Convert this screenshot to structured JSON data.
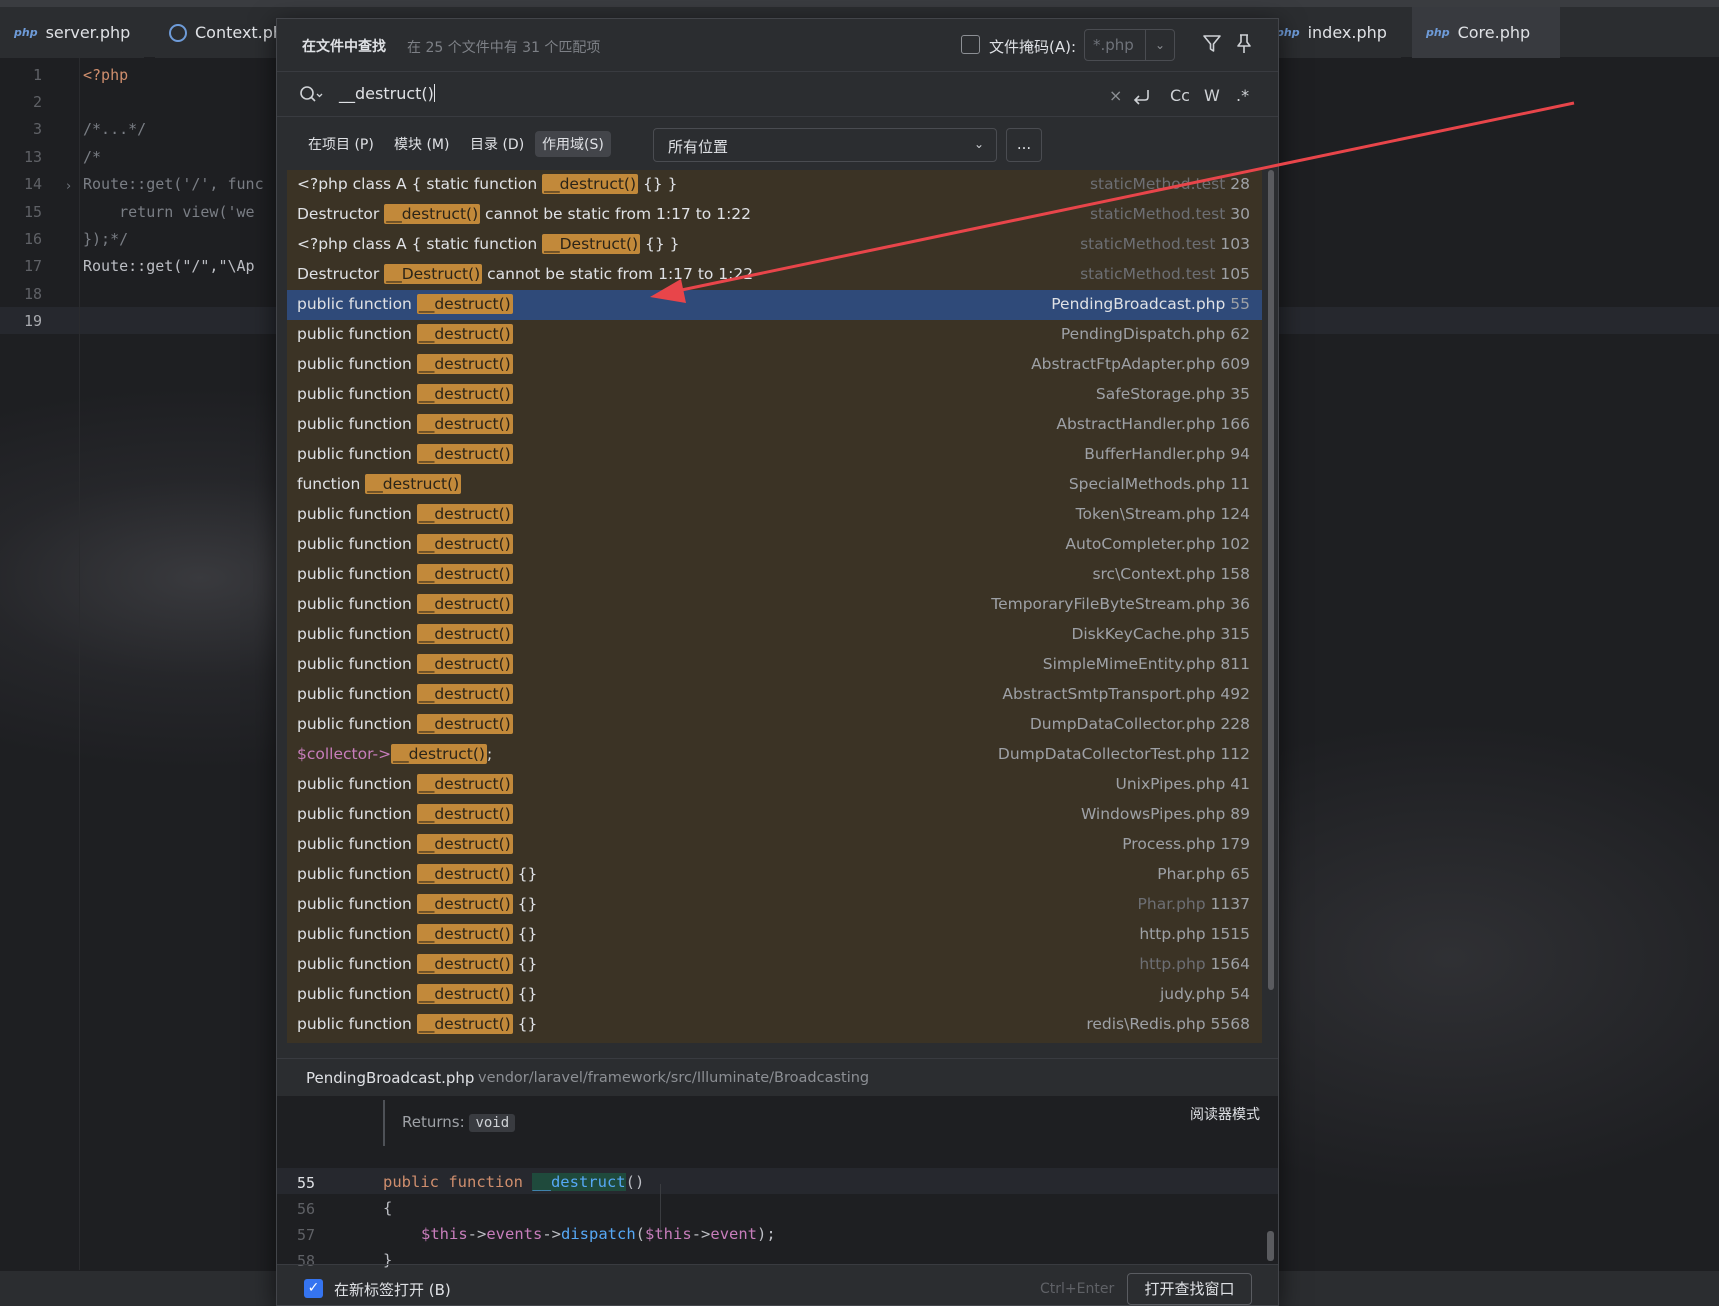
{
  "tabs": [
    {
      "label": "server.php",
      "icon": "php-file-icon"
    },
    {
      "label": "Context.ph",
      "icon": "class-file-icon"
    },
    {
      "label": "index.php",
      "icon": "php-file-icon"
    },
    {
      "label": "Core.php",
      "icon": "php-file-icon"
    }
  ],
  "editor": {
    "line_numbers": [
      "1",
      "2",
      "3",
      "13",
      "14",
      "15",
      "16",
      "17",
      "18",
      "19"
    ],
    "lines": [
      "<?php",
      "",
      "/*...*/",
      "/*",
      "Route::get('/', func",
      "    return view('we",
      "});*/",
      "Route::get(\"/\",\"\\Ap",
      "",
      ""
    ]
  },
  "dialog": {
    "title": "在文件中查找",
    "subtitle": "在 25 个文件中有 31 个匹配项",
    "file_mask_label": "文件掩码(A):",
    "file_mask_value": "*.php",
    "search_query": "__destruct()",
    "search_buttons": [
      "Cc",
      "W",
      ".*"
    ],
    "scopes": [
      "在项目 (P)",
      "模块 (M)",
      "目录 (D)",
      "作用域(S)"
    ],
    "selected_scope": "作用域(S)",
    "scope_select_value": "所有位置",
    "more_button": "...",
    "results": [
      {
        "pre": "<?php class A { static function ",
        "match": "__destruct()",
        "post": " {} }",
        "file": "staticMethod.test",
        "line": "28",
        "dim": true
      },
      {
        "pre": "Destructor ",
        "match": "__destruct()",
        "post": " cannot be static from 1:17 to 1:22",
        "file": "staticMethod.test",
        "line": "30",
        "dim": true
      },
      {
        "pre": "<?php class A { static function ",
        "match": "__Destruct()",
        "post": " {} }",
        "file": "staticMethod.test",
        "line": "103",
        "dim": true
      },
      {
        "pre": "Destructor ",
        "match": "__Destruct()",
        "post": " cannot be static from 1:17 to 1:22",
        "file": "staticMethod.test",
        "line": "105",
        "dim": true
      },
      {
        "pre": "public function ",
        "match": "__destruct()",
        "post": "",
        "file": "PendingBroadcast.php",
        "line": "55",
        "selected": true
      },
      {
        "pre": "public function ",
        "match": "__destruct()",
        "post": "",
        "file": "PendingDispatch.php",
        "line": "62"
      },
      {
        "pre": "public function ",
        "match": "__destruct()",
        "post": "",
        "file": "AbstractFtpAdapter.php",
        "line": "609"
      },
      {
        "pre": "public function ",
        "match": "__destruct()",
        "post": "",
        "file": "SafeStorage.php",
        "line": "35"
      },
      {
        "pre": "public function ",
        "match": "__destruct()",
        "post": "",
        "file": "AbstractHandler.php",
        "line": "166"
      },
      {
        "pre": "public function ",
        "match": "__destruct()",
        "post": "",
        "file": "BufferHandler.php",
        "line": "94"
      },
      {
        "pre": "function ",
        "match": "__destruct()",
        "post": "",
        "file": "SpecialMethods.php",
        "line": "11"
      },
      {
        "pre": "public function ",
        "match": "__destruct()",
        "post": "",
        "file": "Token\\Stream.php",
        "line": "124"
      },
      {
        "pre": "public function ",
        "match": "__destruct()",
        "post": "",
        "file": "AutoCompleter.php",
        "line": "102"
      },
      {
        "pre": "public function ",
        "match": "__destruct()",
        "post": "",
        "file": "src\\Context.php",
        "line": "158"
      },
      {
        "pre": "public function ",
        "match": "__destruct()",
        "post": "",
        "file": "TemporaryFileByteStream.php",
        "line": "36"
      },
      {
        "pre": "public function ",
        "match": "__destruct()",
        "post": "",
        "file": "DiskKeyCache.php",
        "line": "315"
      },
      {
        "pre": "public function ",
        "match": "__destruct()",
        "post": "",
        "file": "SimpleMimeEntity.php",
        "line": "811"
      },
      {
        "pre": "public function ",
        "match": "__destruct()",
        "post": "",
        "file": "AbstractSmtpTransport.php",
        "line": "492"
      },
      {
        "pre": "public function ",
        "match": "__destruct()",
        "post": "",
        "file": "DumpDataCollector.php",
        "line": "228"
      },
      {
        "pre": "$collector->",
        "match": "__destruct()",
        "post": ";",
        "file": "DumpDataCollectorTest.php",
        "line": "112",
        "var": true
      },
      {
        "pre": "public function ",
        "match": "__destruct()",
        "post": "",
        "file": "UnixPipes.php",
        "line": "41"
      },
      {
        "pre": "public function ",
        "match": "__destruct()",
        "post": "",
        "file": "WindowsPipes.php",
        "line": "89"
      },
      {
        "pre": "public function ",
        "match": "__destruct()",
        "post": "",
        "file": "Process.php",
        "line": "179"
      },
      {
        "pre": "public function ",
        "match": "__destruct()",
        "post": " {}",
        "file": "Phar.php",
        "line": "65"
      },
      {
        "pre": "public function ",
        "match": "__destruct()",
        "post": " {}",
        "file": "Phar.php",
        "line": "1137",
        "dim": true
      },
      {
        "pre": "public function ",
        "match": "__destruct()",
        "post": " {}",
        "file": "http.php",
        "line": "1515"
      },
      {
        "pre": "public function ",
        "match": "__destruct()",
        "post": " {}",
        "file": "http.php",
        "line": "1564",
        "dim": true
      },
      {
        "pre": "public function ",
        "match": "__destruct()",
        "post": " {}",
        "file": "judy.php",
        "line": "54"
      },
      {
        "pre": "public function ",
        "match": "__destruct()",
        "post": " {}",
        "file": "redis\\Redis.php",
        "line": "5568"
      }
    ],
    "preview": {
      "file": "PendingBroadcast.php",
      "path": "vendor/laravel/framework/src/Illuminate/Broadcasting",
      "reader_mode": "阅读器模式",
      "returns_label": "Returns:",
      "returns_type": "void",
      "line_numbers": [
        "55",
        "56",
        "57",
        "58"
      ],
      "code": {
        "l55_kw": "public function ",
        "l55_fn": "__destruct",
        "l55_paren": "()",
        "l56": "{",
        "l57_this1": "$this",
        "l57_a1": "->",
        "l57_events": "events",
        "l57_a2": "->",
        "l57_dispatch": "dispatch",
        "l57_p1": "(",
        "l57_this2": "$this",
        "l57_a3": "->",
        "l57_event": "event",
        "l57_end": ");",
        "l58": "}"
      }
    },
    "footer": {
      "new_tab_label": "在新标签打开 (B)",
      "new_tab_checked": true,
      "shortcut_hint": "Ctrl+Enter",
      "open_window_button": "打开查找窗口"
    }
  },
  "colors": {
    "match_highlight": "#c2893a",
    "selected_row": "#2f4a79",
    "results_bg": "#3b3325",
    "annotation_arrow": "#e8454a"
  }
}
